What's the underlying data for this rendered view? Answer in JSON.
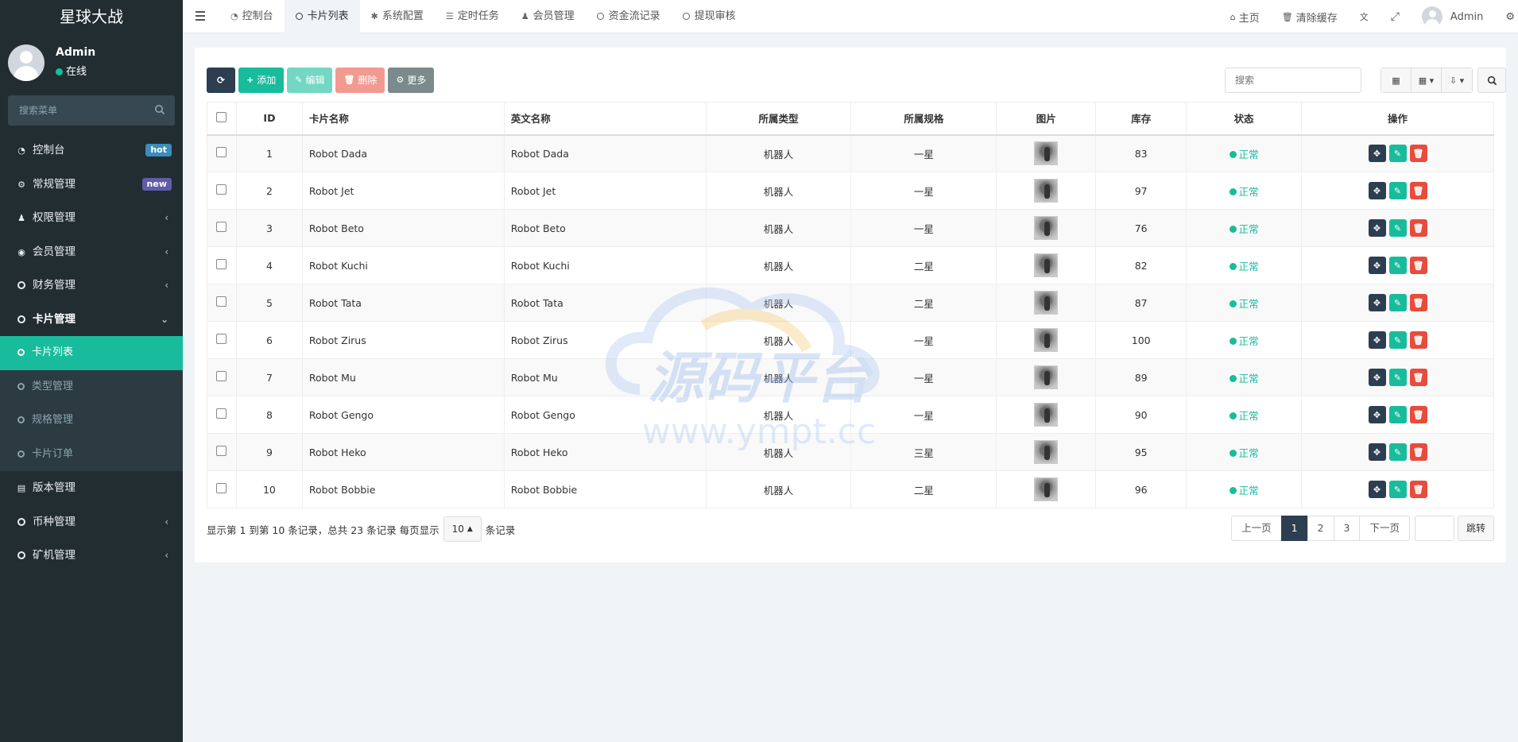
{
  "app": {
    "title": "星球大战"
  },
  "user": {
    "name": "Admin",
    "status": "在线"
  },
  "sidebar": {
    "search_placeholder": "搜索菜单",
    "items": [
      {
        "label": "控制台",
        "icon": "dashboard-icon",
        "badge": "hot",
        "badge_color": "#3c8dbc"
      },
      {
        "label": "常规管理",
        "icon": "cogs-icon",
        "badge": "new",
        "badge_color": "#605ca8"
      },
      {
        "label": "权限管理",
        "icon": "group-icon"
      },
      {
        "label": "会员管理",
        "icon": "user-circle-icon"
      },
      {
        "label": "财务管理",
        "icon": "circle-icon"
      },
      {
        "label": "卡片管理",
        "icon": "circle-icon",
        "expanded": true
      }
    ],
    "sub_items": [
      {
        "label": "卡片列表",
        "active": true
      },
      {
        "label": "类型管理"
      },
      {
        "label": "规格管理"
      },
      {
        "label": "卡片订单"
      }
    ],
    "after_items": [
      {
        "label": "版本管理",
        "icon": "file-icon"
      },
      {
        "label": "币种管理",
        "icon": "circle-icon"
      },
      {
        "label": "矿机管理",
        "icon": "circle-icon"
      }
    ]
  },
  "topbar": {
    "tabs": [
      {
        "label": "控制台",
        "icon": "dashboard-icon"
      },
      {
        "label": "卡片列表",
        "icon": "circle-icon",
        "active": true
      },
      {
        "label": "系统配置",
        "icon": "gear-icon"
      },
      {
        "label": "定时任务",
        "icon": "tasks-icon"
      },
      {
        "label": "会员管理",
        "icon": "user-icon"
      },
      {
        "label": "资金流记录",
        "icon": "circle-icon"
      },
      {
        "label": "提现审核",
        "icon": "circle-icon"
      }
    ],
    "home": "主页",
    "clear_cache": "清除缓存",
    "user": "Admin"
  },
  "toolbar": {
    "add": "添加",
    "edit": "编辑",
    "delete": "删除",
    "more": "更多",
    "search_placeholder": "搜索"
  },
  "table": {
    "columns": [
      "ID",
      "卡片名称",
      "英文名称",
      "所属类型",
      "所属规格",
      "图片",
      "库存",
      "状态",
      "操作"
    ],
    "rows": [
      {
        "id": "1",
        "name": "Robot Dada",
        "en": "Robot Dada",
        "type": "机器人",
        "spec": "一星",
        "stock": "83",
        "status": "正常"
      },
      {
        "id": "2",
        "name": "Robot Jet",
        "en": "Robot Jet",
        "type": "机器人",
        "spec": "一星",
        "stock": "97",
        "status": "正常"
      },
      {
        "id": "3",
        "name": "Robot Beto",
        "en": "Robot Beto",
        "type": "机器人",
        "spec": "一星",
        "stock": "76",
        "status": "正常"
      },
      {
        "id": "4",
        "name": "Robot Kuchi",
        "en": "Robot Kuchi",
        "type": "机器人",
        "spec": "二星",
        "stock": "82",
        "status": "正常"
      },
      {
        "id": "5",
        "name": "Robot Tata",
        "en": "Robot Tata",
        "type": "机器人",
        "spec": "二星",
        "stock": "87",
        "status": "正常"
      },
      {
        "id": "6",
        "name": "Robot Zirus",
        "en": "Robot Zirus",
        "type": "机器人",
        "spec": "一星",
        "stock": "100",
        "status": "正常"
      },
      {
        "id": "7",
        "name": "Robot Mu",
        "en": "Robot Mu",
        "type": "机器人",
        "spec": "一星",
        "stock": "89",
        "status": "正常"
      },
      {
        "id": "8",
        "name": "Robot Gengo",
        "en": "Robot Gengo",
        "type": "机器人",
        "spec": "一星",
        "stock": "90",
        "status": "正常"
      },
      {
        "id": "9",
        "name": "Robot Heko",
        "en": "Robot Heko",
        "type": "机器人",
        "spec": "三星",
        "stock": "95",
        "status": "正常"
      },
      {
        "id": "10",
        "name": "Robot Bobbie",
        "en": "Robot Bobbie",
        "type": "机器人",
        "spec": "二星",
        "stock": "96",
        "status": "正常"
      }
    ]
  },
  "footer": {
    "info_prefix": "显示第 1 到第 10 条记录，总共 23 条记录 每页显示",
    "page_size": "10",
    "info_suffix": "条记录"
  },
  "pager": {
    "prev": "上一页",
    "pages": [
      "1",
      "2",
      "3"
    ],
    "next": "下一页",
    "jump": "跳转"
  },
  "watermark": {
    "cn": "源码平台",
    "url": "www.ympt.cc"
  },
  "colors": {
    "accent": "#18bc9c",
    "sidebar_bg": "#222d32",
    "danger": "#e74c3c",
    "dark": "#2c3e50"
  }
}
